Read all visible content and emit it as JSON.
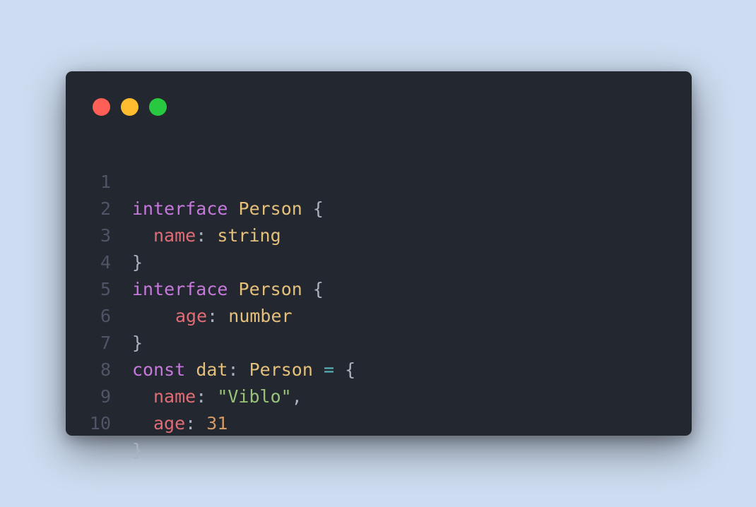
{
  "colors": {
    "background": "#cddcf0",
    "window": "#23272f",
    "keyword": "#c678dd",
    "type": "#e5c07b",
    "property": "#e06c75",
    "string": "#98c379",
    "number": "#d19a66",
    "operator": "#56b6c2",
    "punctuation": "#abb2bf",
    "line_number": "#4d5566"
  },
  "window_controls": [
    {
      "name": "close",
      "color": "#ff5f57"
    },
    {
      "name": "minimize",
      "color": "#febc2e"
    },
    {
      "name": "maximize",
      "color": "#28c840"
    }
  ],
  "code": {
    "lines": [
      {
        "number": "1",
        "tokens": [
          {
            "text": "interface",
            "kind": "keyword"
          },
          {
            "text": " Person ",
            "kind": "type"
          },
          {
            "text": "{",
            "kind": "punctuation"
          }
        ]
      },
      {
        "number": "2",
        "tokens": [
          {
            "text": "name",
            "kind": "property"
          },
          {
            "text": ": ",
            "kind": "punctuation"
          },
          {
            "text": "string",
            "kind": "type"
          }
        ]
      },
      {
        "number": "3",
        "tokens": [
          {
            "text": "}",
            "kind": "punctuation"
          }
        ]
      },
      {
        "number": "4",
        "tokens": [
          {
            "text": "interface",
            "kind": "keyword"
          },
          {
            "text": " Person ",
            "kind": "type"
          },
          {
            "text": "{",
            "kind": "punctuation"
          }
        ]
      },
      {
        "number": "5",
        "tokens": [
          {
            "text": "age",
            "kind": "property"
          },
          {
            "text": ": ",
            "kind": "punctuation"
          },
          {
            "text": "number",
            "kind": "type"
          }
        ]
      },
      {
        "number": "6",
        "tokens": [
          {
            "text": "}",
            "kind": "punctuation"
          }
        ]
      },
      {
        "number": "7",
        "tokens": [
          {
            "text": "const",
            "kind": "keyword"
          },
          {
            "text": " dat",
            "kind": "type"
          },
          {
            "text": ": ",
            "kind": "punctuation"
          },
          {
            "text": "Person ",
            "kind": "type"
          },
          {
            "text": "=",
            "kind": "operator"
          },
          {
            "text": " {",
            "kind": "punctuation"
          }
        ]
      },
      {
        "number": "8",
        "tokens": [
          {
            "text": "name",
            "kind": "property"
          },
          {
            "text": ": ",
            "kind": "punctuation"
          },
          {
            "text": "\"Viblo\"",
            "kind": "string"
          },
          {
            "text": ",",
            "kind": "punctuation"
          }
        ]
      },
      {
        "number": "9",
        "tokens": [
          {
            "text": "age",
            "kind": "property"
          },
          {
            "text": ": ",
            "kind": "punctuation"
          },
          {
            "text": "31",
            "kind": "number"
          }
        ]
      },
      {
        "number": "10",
        "tokens": [
          {
            "text": "}",
            "kind": "punctuation"
          }
        ]
      }
    ]
  }
}
